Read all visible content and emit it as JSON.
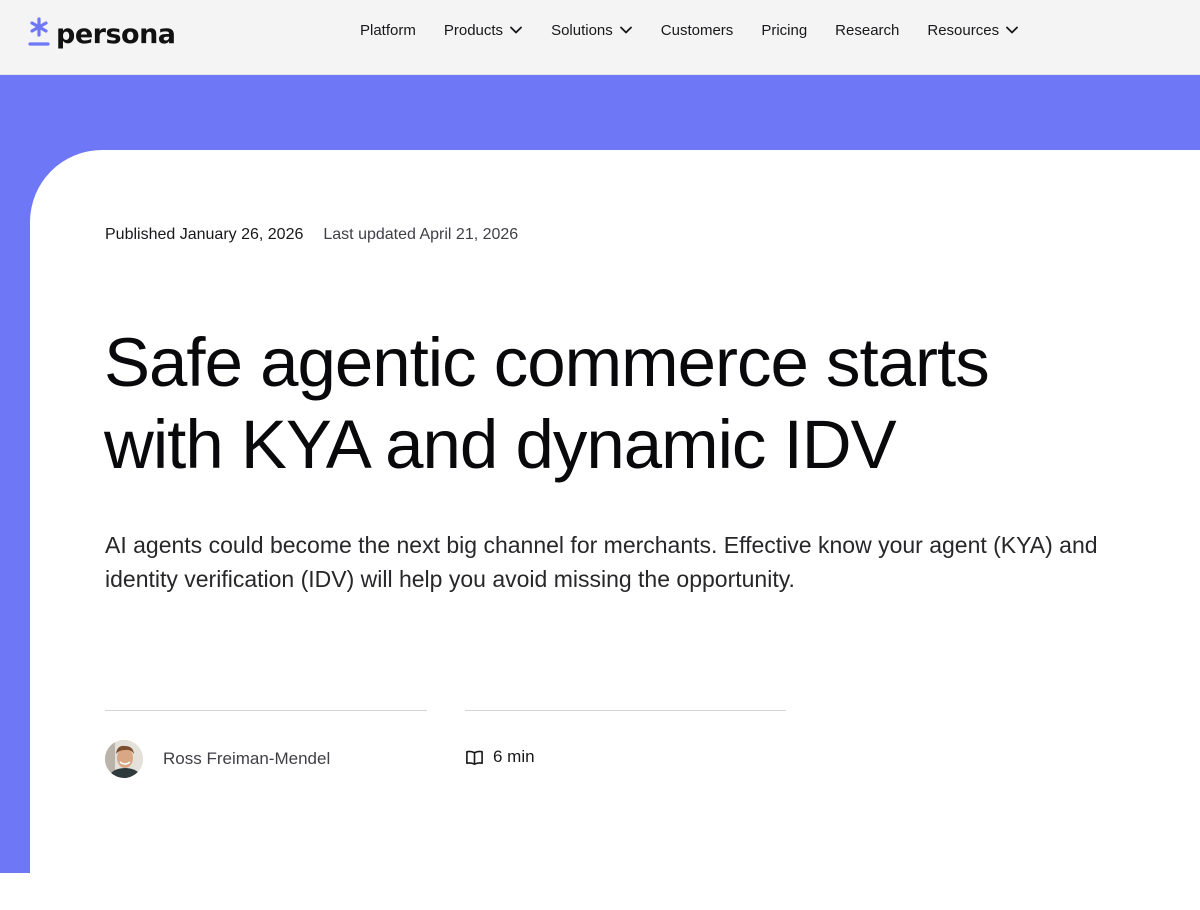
{
  "brand": {
    "name": "persona",
    "accent_color": "#6e78f7",
    "logo_icon": "asterisk-logo-icon"
  },
  "nav": {
    "items": [
      {
        "label": "Platform",
        "has_dropdown": false
      },
      {
        "label": "Products",
        "has_dropdown": true
      },
      {
        "label": "Solutions",
        "has_dropdown": true
      },
      {
        "label": "Customers",
        "has_dropdown": false
      },
      {
        "label": "Pricing",
        "has_dropdown": false
      },
      {
        "label": "Research",
        "has_dropdown": false
      },
      {
        "label": "Resources",
        "has_dropdown": true
      }
    ],
    "dropdown_icon": "chevron-down-icon"
  },
  "article": {
    "published": "Published January 26, 2026",
    "updated": "Last updated April 21, 2026",
    "title_line1": "Safe agentic commerce starts",
    "title_line2": "with KYA and dynamic IDV",
    "subtitle_line1": "AI agents could become the next big channel for merchants. Effective know your agent (KYA) and",
    "subtitle_line2": "identity verification (IDV) will help you avoid missing the opportunity.",
    "author": {
      "name": "Ross Freiman-Mendel",
      "avatar_icon": "author-avatar"
    },
    "read_time": {
      "label": "6 min",
      "icon": "book-open-icon"
    }
  },
  "colors": {
    "nav_background": "#f4f4f5",
    "hero_band": "#6e78f7",
    "card_background": "#ffffff",
    "text_primary": "#09090b"
  }
}
